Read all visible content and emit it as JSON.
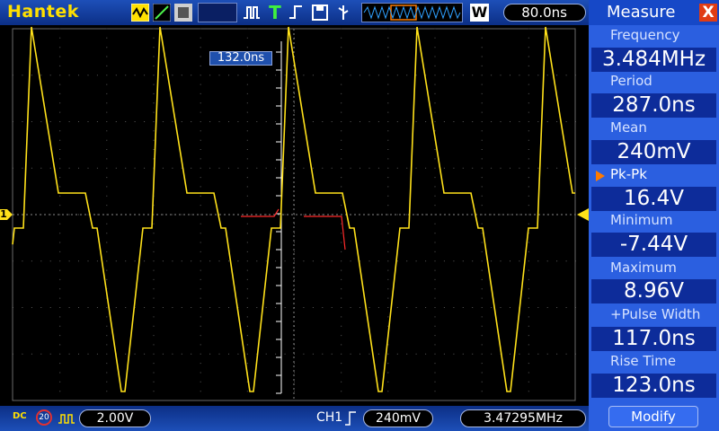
{
  "brand": "Hantek",
  "toolbar": {
    "timebase": "80.0ns",
    "window_icon_label": "W",
    "trigger_time_marker": "132.0ns"
  },
  "status_bar": {
    "coupling": "DC",
    "bandwidth_limit": "20",
    "ch1_scale": "2.00V",
    "trigger_source": "CH1",
    "trigger_level": "240mV",
    "frequency_counter": "3.47295MHz"
  },
  "measure_panel": {
    "title": "Measure",
    "close_label": "X",
    "modify_label": "Modify",
    "items": [
      {
        "label": "Frequency",
        "value": "3.484MHz"
      },
      {
        "label": "Period",
        "value": "287.0ns"
      },
      {
        "label": "Mean",
        "value": "240mV"
      },
      {
        "label": "Pk-Pk",
        "value": "16.4V"
      },
      {
        "label": "Minimum",
        "value": "-7.44V"
      },
      {
        "label": "Maximum",
        "value": "8.96V"
      },
      {
        "label": "+Pulse Width",
        "value": "117.0ns"
      },
      {
        "label": "Rise Time",
        "value": "123.0ns"
      }
    ],
    "selected_index": 3
  },
  "markers": {
    "ch1_marker": "1"
  },
  "colors": {
    "trace": "#ffe11a",
    "grid": "#5a5a5a",
    "panel_bg": "#2b5fe0",
    "value_box": "#0d2c9a",
    "highlight": "#ff7a00",
    "overlay_red": "#ff2a2a"
  }
}
